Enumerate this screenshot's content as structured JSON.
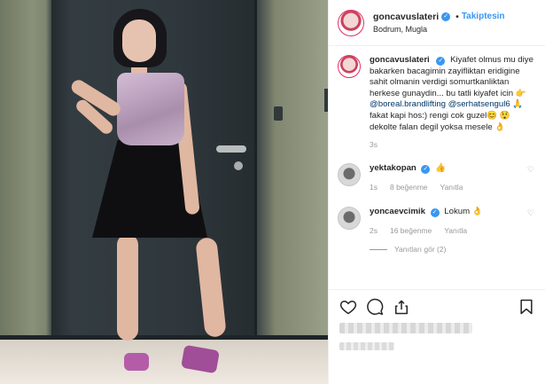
{
  "post": {
    "username": "goncavuslateri",
    "follow_label": "Takiptesin",
    "location": "Bodrum, Mugla"
  },
  "caption": {
    "username": "goncavuslateri",
    "line1": "Kiyafet olmus mu diye bakarken bacagimin zayifliktan eridigine sahit olmanin verdigi somurtkanliktan herkese gunaydin... bu tatli kiyafet icin",
    "emoji1": "👉",
    "mention1": "@boreal.brandlifting",
    "mention2": "@serhatsengul6",
    "emoji2": "🙏",
    "line2": "fakat kapi hos:) rengi cok guzel",
    "emoji3": "😊",
    "emoji4": "😲",
    "line3": "dekolte falan degil yoksa mesele",
    "emoji5": "👌",
    "time": "3s"
  },
  "comments": [
    {
      "username": "yektakopan",
      "text": "👍",
      "time": "1s",
      "likes": "8 beğenme",
      "reply": "Yanıtla"
    },
    {
      "username": "yoncaevcimik",
      "text": "Lokum 👌",
      "time": "2s",
      "likes": "16 beğenme",
      "reply": "Yanıtla"
    }
  ],
  "view_replies": "Yanıtları gör (2)",
  "icons": {
    "like": "heart-icon",
    "comment": "comment-icon",
    "share": "share-icon",
    "save": "bookmark-icon",
    "verified": "verified-badge-icon"
  },
  "colors": {
    "accent": "#3897f0",
    "text": "#262626",
    "muted": "#999999",
    "mention": "#003569"
  }
}
